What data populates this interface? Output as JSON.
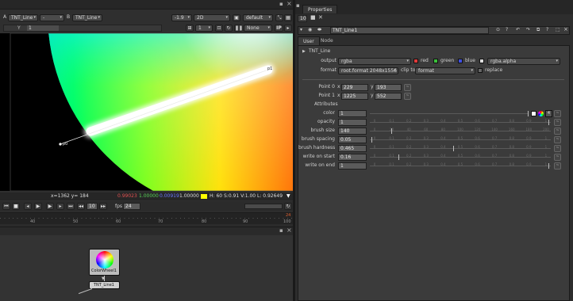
{
  "viewer": {
    "input_a_label": "A",
    "input_a_value": "TNT_Line",
    "composite_op": "-",
    "input_b_label": "B",
    "input_b_value": "TNT_Line",
    "gain_value": "-1.9",
    "view_mode": "2D",
    "lut_value": "default",
    "frame_step_label": "Y",
    "frame_value": "1",
    "proxy_value": "1",
    "roi_value": "None",
    "ip_label": "IP",
    "status": {
      "coords": "x=1362 y= 184",
      "r": "0.99023",
      "g": "1.00000",
      "b": "0.00919",
      "a": "1.00000",
      "hsvl": "H: 60 S:0.91 V:1.00  L: 0.92649"
    },
    "line_end_label": "p1",
    "line_start_label": "p0"
  },
  "timeline": {
    "frame_value": "10",
    "fps_label": "fps",
    "fps_value": "24",
    "ticks": [
      "40",
      "50",
      "60",
      "70",
      "80",
      "90",
      "100"
    ],
    "end_marker": "24"
  },
  "nodegraph": {
    "node_colorwheel": "ColorWheel1",
    "node_line": "TNT_Line1"
  },
  "properties": {
    "panel_tab": "Properties",
    "count": "10",
    "node_name": "TNT_Line1",
    "tabs": [
      "User",
      "Node"
    ],
    "section_title": "TNT_Line",
    "output_label": "output",
    "output_value": "rgba",
    "channels": [
      "red",
      "green",
      "blue"
    ],
    "alpha_value": "rgba.alpha",
    "format_label": "format",
    "format_value": "root.format 2048x1556",
    "clip_label": "clip to",
    "clip_value": "format",
    "replace_label": "replace",
    "point0_label": "Point 0",
    "point0_x": "229",
    "point0_y": "193",
    "point1_label": "Point 1",
    "point1_x": "1225",
    "point1_y": "552",
    "x_label": "x",
    "y_label": "y",
    "attributes_label": "Attributes",
    "color_label": "color",
    "color_value": "1",
    "rows": [
      {
        "label": "opacity",
        "value": "1"
      },
      {
        "label": "brush size",
        "value": "140"
      },
      {
        "label": "brush spacing",
        "value": "0.05"
      },
      {
        "label": "brush hardness",
        "value": "0.465"
      },
      {
        "label": "write on start",
        "value": "0.16"
      },
      {
        "label": "write on end",
        "value": "1"
      }
    ],
    "slider_ticks_a": [
      "0",
      "0.1",
      "0.2",
      "0.3",
      "0.4",
      "0.5",
      "0.6",
      "0.7",
      "0.8",
      "0.9",
      "1"
    ],
    "slider_ticks_b": [
      "0",
      "20",
      "40",
      "60",
      "80",
      "100",
      "120",
      "140",
      "160",
      "180",
      "200"
    ],
    "slider_ticks_c": [
      "0",
      "0.1",
      "0.2",
      "0.3",
      "0.4",
      "0.5",
      "0.6",
      "0.7",
      "0.8",
      "0.9",
      "1"
    ]
  },
  "colors": {
    "accent_yellow": "#ffd400",
    "red_text": "#e05050",
    "green_text": "#58d058",
    "blue_text": "#6a78ff"
  }
}
